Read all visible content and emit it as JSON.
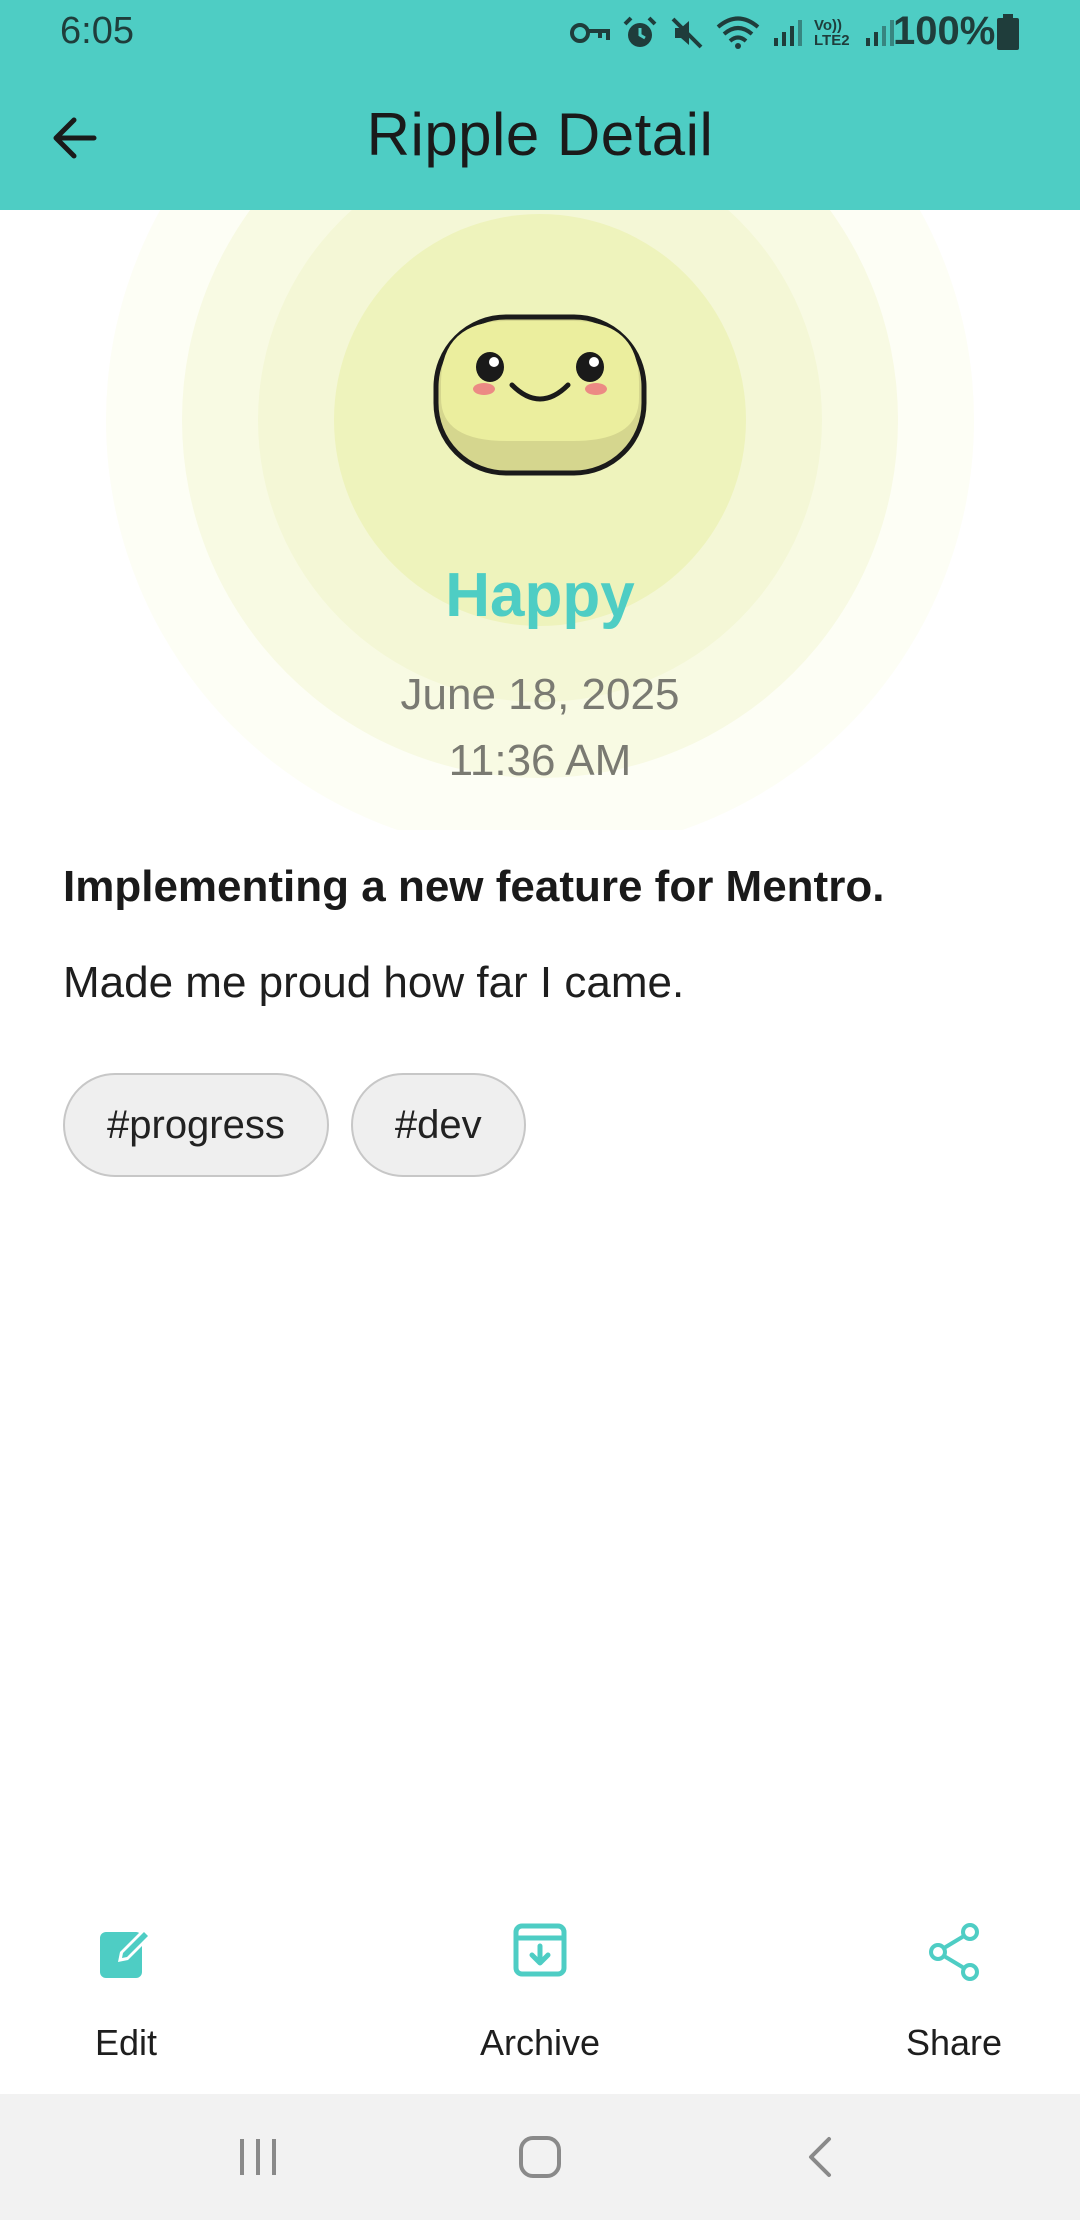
{
  "status_bar": {
    "time": "6:05",
    "battery": "100%",
    "network_label": "Vo)) LTE2",
    "icons": [
      "vpn-key-icon",
      "alarm-icon",
      "mute-icon",
      "wifi-icon",
      "signal-icon",
      "volte-icon",
      "signal-icon",
      "battery-icon"
    ]
  },
  "header": {
    "title": "Ripple Detail",
    "back_icon": "arrow-left-icon",
    "background_color": "#4ecdc4"
  },
  "mood": {
    "label": "Happy",
    "date": "June 18, 2025",
    "time": "11:36 AM",
    "icon": "happy-face-icon",
    "accent_color": "#4ecdc4",
    "glow_color": "#eef3bc"
  },
  "entry": {
    "title": "Implementing a new feature for Mentro.",
    "body": "Made me proud how far I came.",
    "tags": [
      "#progress",
      "#dev"
    ]
  },
  "actions": [
    {
      "label": "Edit",
      "icon": "edit-icon"
    },
    {
      "label": "Archive",
      "icon": "archive-icon"
    },
    {
      "label": "Share",
      "icon": "share-icon"
    }
  ],
  "nav_bar": {
    "buttons": [
      "recents-icon",
      "home-icon",
      "back-icon"
    ]
  }
}
